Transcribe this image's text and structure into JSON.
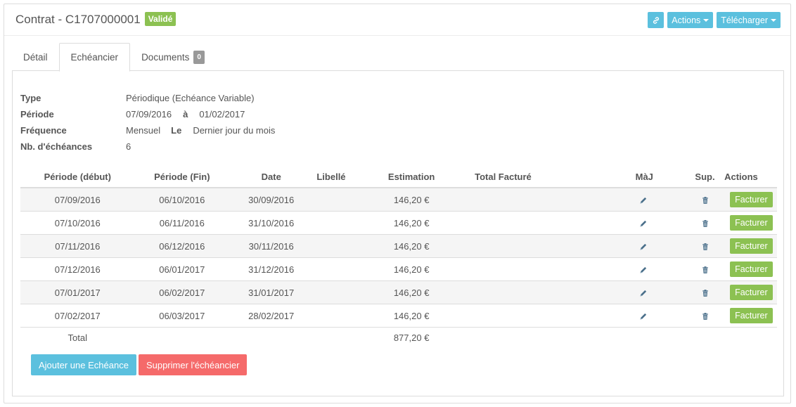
{
  "header": {
    "title": "Contrat - C1707000001",
    "status_badge": "Validé",
    "actions_label": "Actions",
    "download_label": "Télécharger"
  },
  "tabs": [
    {
      "label": "Détail"
    },
    {
      "label": "Echéancier",
      "active": true
    },
    {
      "label": "Documents",
      "badge": "0"
    }
  ],
  "info": {
    "type_label": "Type",
    "type_value": "Périodique (Echéance Variable)",
    "period_label": "Période",
    "period_start": "07/09/2016",
    "period_sep": "à",
    "period_end": "01/02/2017",
    "freq_label": "Fréquence",
    "freq_value": "Mensuel",
    "freq_sep": "Le",
    "freq_day": "Dernier jour du mois",
    "count_label": "Nb. d'échéances",
    "count_value": "6"
  },
  "table": {
    "headers": {
      "start": "Période (début)",
      "end": "Période (Fin)",
      "date": "Date",
      "label": "Libellé",
      "estimate": "Estimation",
      "total_billed": "Total Facturé",
      "update": "MàJ",
      "delete": "Sup.",
      "actions": "Actions"
    },
    "rows": [
      {
        "start": "07/09/2016",
        "end": "06/10/2016",
        "date": "30/09/2016",
        "label": "",
        "estimate": "146,20 €",
        "total_billed": "",
        "action": "Facturer"
      },
      {
        "start": "07/10/2016",
        "end": "06/11/2016",
        "date": "31/10/2016",
        "label": "",
        "estimate": "146,20 €",
        "total_billed": "",
        "action": "Facturer"
      },
      {
        "start": "07/11/2016",
        "end": "06/12/2016",
        "date": "30/11/2016",
        "label": "",
        "estimate": "146,20 €",
        "total_billed": "",
        "action": "Facturer"
      },
      {
        "start": "07/12/2016",
        "end": "06/01/2017",
        "date": "31/12/2016",
        "label": "",
        "estimate": "146,20 €",
        "total_billed": "",
        "action": "Facturer"
      },
      {
        "start": "07/01/2017",
        "end": "06/02/2017",
        "date": "31/01/2017",
        "label": "",
        "estimate": "146,20 €",
        "total_billed": "",
        "action": "Facturer"
      },
      {
        "start": "07/02/2017",
        "end": "06/03/2017",
        "date": "28/02/2017",
        "label": "",
        "estimate": "146,20 €",
        "total_billed": "",
        "action": "Facturer"
      }
    ],
    "total_label": "Total",
    "total_value": "877,20 €"
  },
  "buttons": {
    "add": "Ajouter une Echéance",
    "remove": "Supprimer l'échéancier"
  },
  "colors": {
    "info": "#5bc0de",
    "success": "#8cc152",
    "danger": "#f56a6a",
    "muted": "#999999"
  },
  "icons": {
    "link": "link-icon",
    "update": "pencil-icon",
    "delete": "trash-icon",
    "dropdown": "caret-icon"
  }
}
